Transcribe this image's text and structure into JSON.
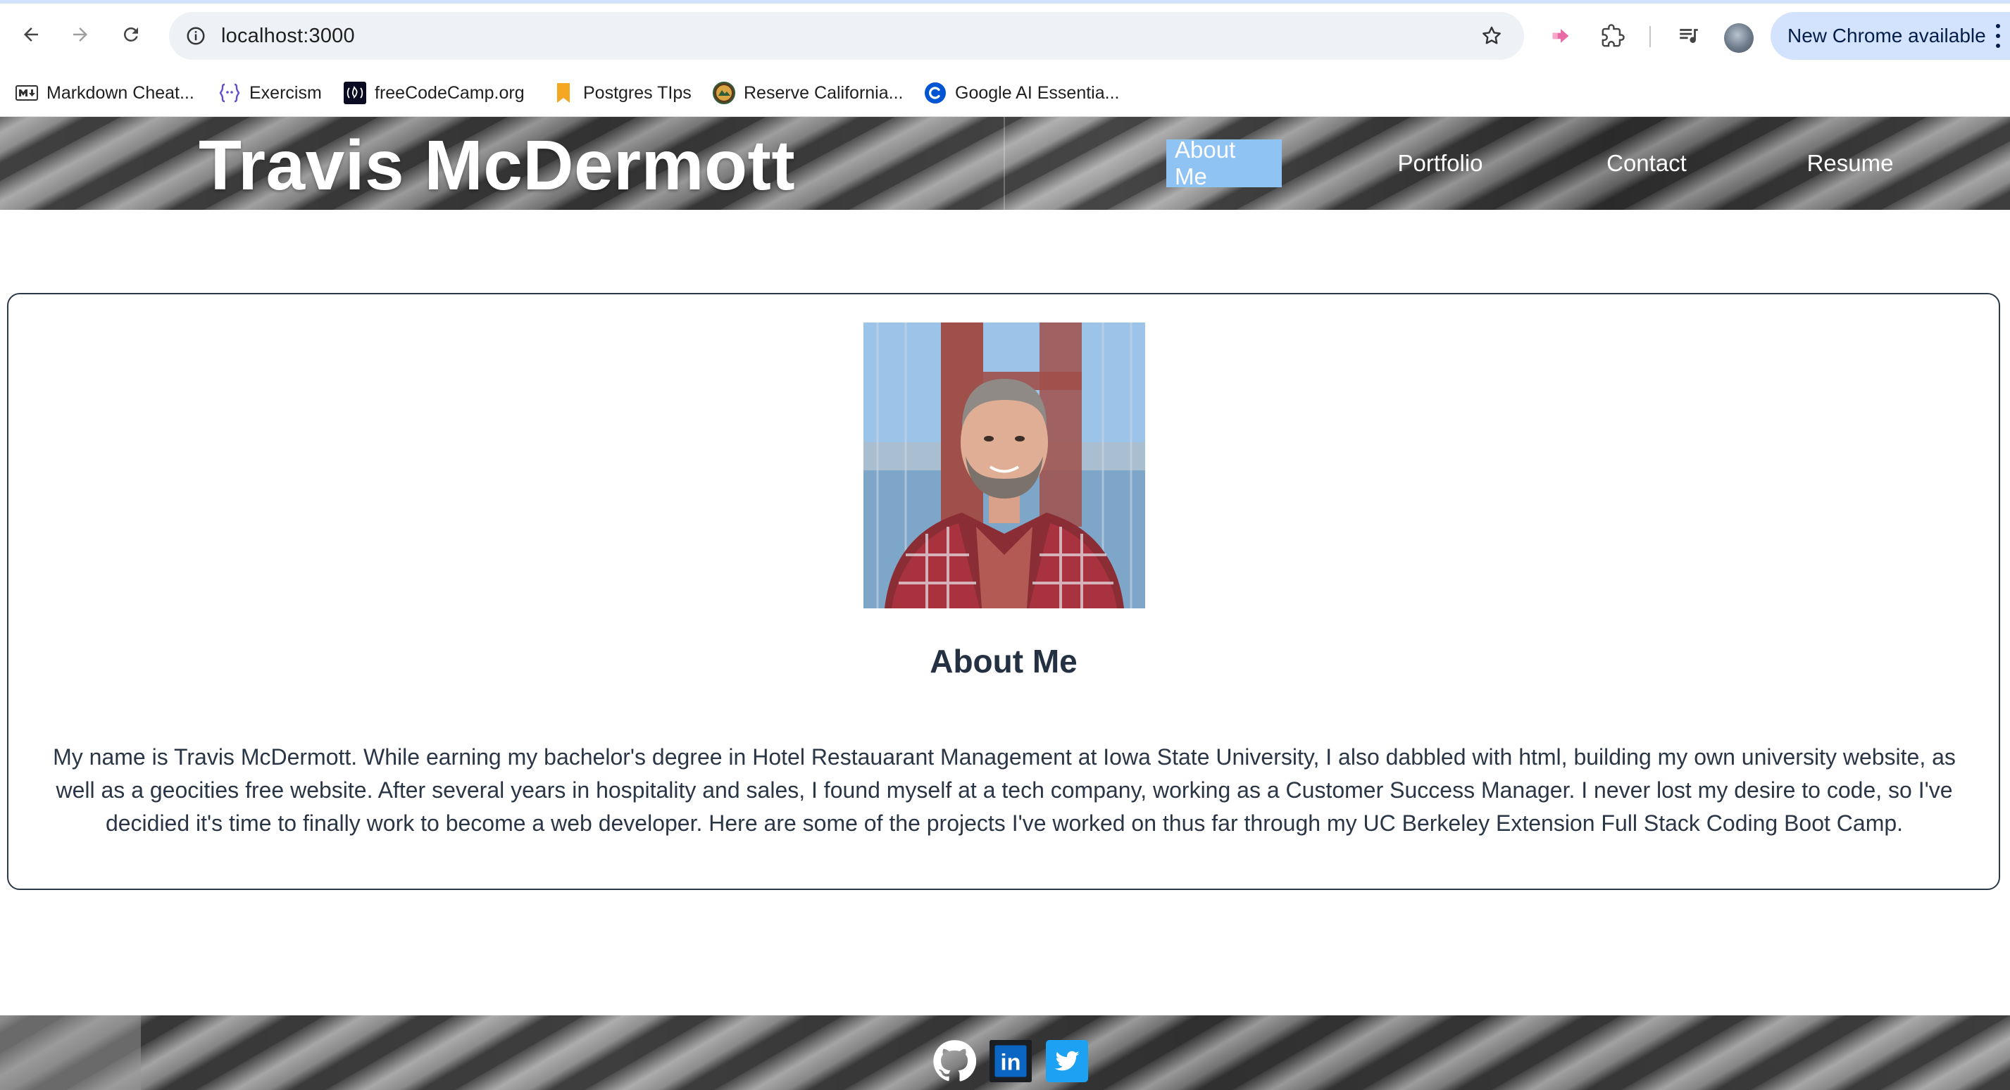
{
  "browser": {
    "url": "localhost:3000",
    "update_label": "New Chrome available",
    "bookmarks": [
      {
        "label": "Markdown Cheat...",
        "icon": "markdown-icon"
      },
      {
        "label": "Exercism",
        "icon": "exercism-icon"
      },
      {
        "label": "freeCodeCamp.org",
        "icon": "freecodecamp-icon"
      },
      {
        "label": "Postgres TIps",
        "icon": "bookmark-icon"
      },
      {
        "label": "Reserve California...",
        "icon": "reserve-california-icon"
      },
      {
        "label": "Google AI Essentia...",
        "icon": "coursera-icon"
      }
    ]
  },
  "site": {
    "title": "Travis McDermott",
    "nav": [
      {
        "label": "About Me",
        "active": true
      },
      {
        "label": "Portfolio",
        "active": false
      },
      {
        "label": "Contact",
        "active": false
      },
      {
        "label": "Resume",
        "active": false
      }
    ],
    "about": {
      "heading": "About Me",
      "body": "My name is Travis McDermott. While earning my bachelor's degree in Hotel Restauarant Management at Iowa State University, I also dabbled with html, building my own university website, as well as a geocities free website. After several years in hospitality and sales, I found myself at a tech company, working as a Customer Success Manager. I never lost my desire to code, so I've decidied it's time to finally work to become a web developer. Here are some of the projects I've worked on thus far through my UC Berkeley Extension Full Stack Coding Boot Camp."
    },
    "footer": {
      "social": [
        {
          "name": "github",
          "icon": "github-icon"
        },
        {
          "name": "linkedin",
          "icon": "linkedin-icon",
          "text": "in"
        },
        {
          "name": "twitter",
          "icon": "twitter-icon"
        }
      ]
    }
  },
  "colors": {
    "active_nav_bg": "#8fc3f4",
    "card_border": "#2b3a48",
    "heading": "#233142",
    "update_pill": "#d3e3fd"
  }
}
